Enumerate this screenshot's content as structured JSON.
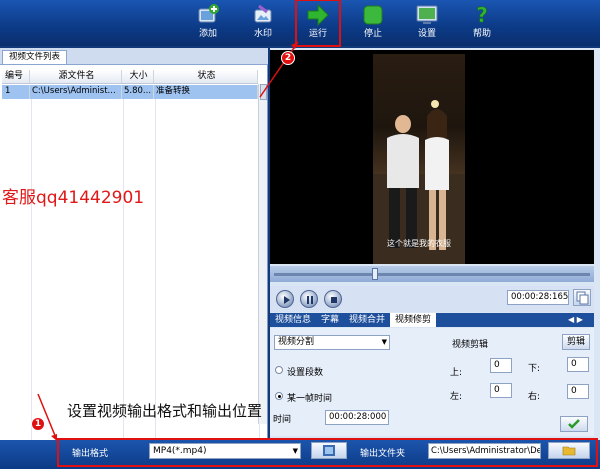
{
  "toolbar": {
    "items": [
      {
        "label": "添加",
        "icon": "add-video-icon"
      },
      {
        "label": "水印",
        "icon": "watermark-icon"
      },
      {
        "label": "运行",
        "icon": "run-arrow-icon"
      },
      {
        "label": "停止",
        "icon": "stop-icon"
      },
      {
        "label": "设置",
        "icon": "settings-monitor-icon"
      },
      {
        "label": "帮助",
        "icon": "help-icon"
      }
    ]
  },
  "file_list": {
    "tab_label": "视频文件列表",
    "columns": [
      "编号",
      "源文件名",
      "大小",
      "状态"
    ],
    "rows": [
      {
        "index": "1",
        "name": "C:\\Users\\Administ...",
        "size": "5.80...",
        "status": "准备转换"
      }
    ]
  },
  "overlay": {
    "service_text": "客服qq41442901",
    "annotation_text": "设置视频输出格式和输出位置",
    "badge_1": "1",
    "badge_2": "2"
  },
  "player": {
    "subtitle": "这个就是我的衣服",
    "time_display": "00:00:28:165"
  },
  "tabs": {
    "items": [
      "视频信息",
      "字幕",
      "视频合并",
      "视频修剪"
    ],
    "active": "视频修剪",
    "nav_arrows": "◀ ▶"
  },
  "trim": {
    "mode_value": "视频分割",
    "crop_title": "视频剪辑",
    "crop_button": "剪辑",
    "radio_segments": "设置段数",
    "radio_point": "某一帧时间",
    "time_label": "时间",
    "time_value": "00:00:28:000",
    "top_label": "上:",
    "top_value": "0",
    "bottom_label": "下:",
    "bottom_value": "0",
    "left_label": "左:",
    "left_value": "0",
    "right_label": "右:",
    "right_value": "0"
  },
  "output": {
    "format_label": "输出格式",
    "format_value": "MP4(*.mp4)",
    "folder_label": "输出文件夹",
    "folder_value": "C:\\Users\\Administrator\\Des"
  },
  "colors": {
    "accent": "#0c3a86",
    "highlight": "#e01010",
    "selection": "#9ec3f0"
  }
}
